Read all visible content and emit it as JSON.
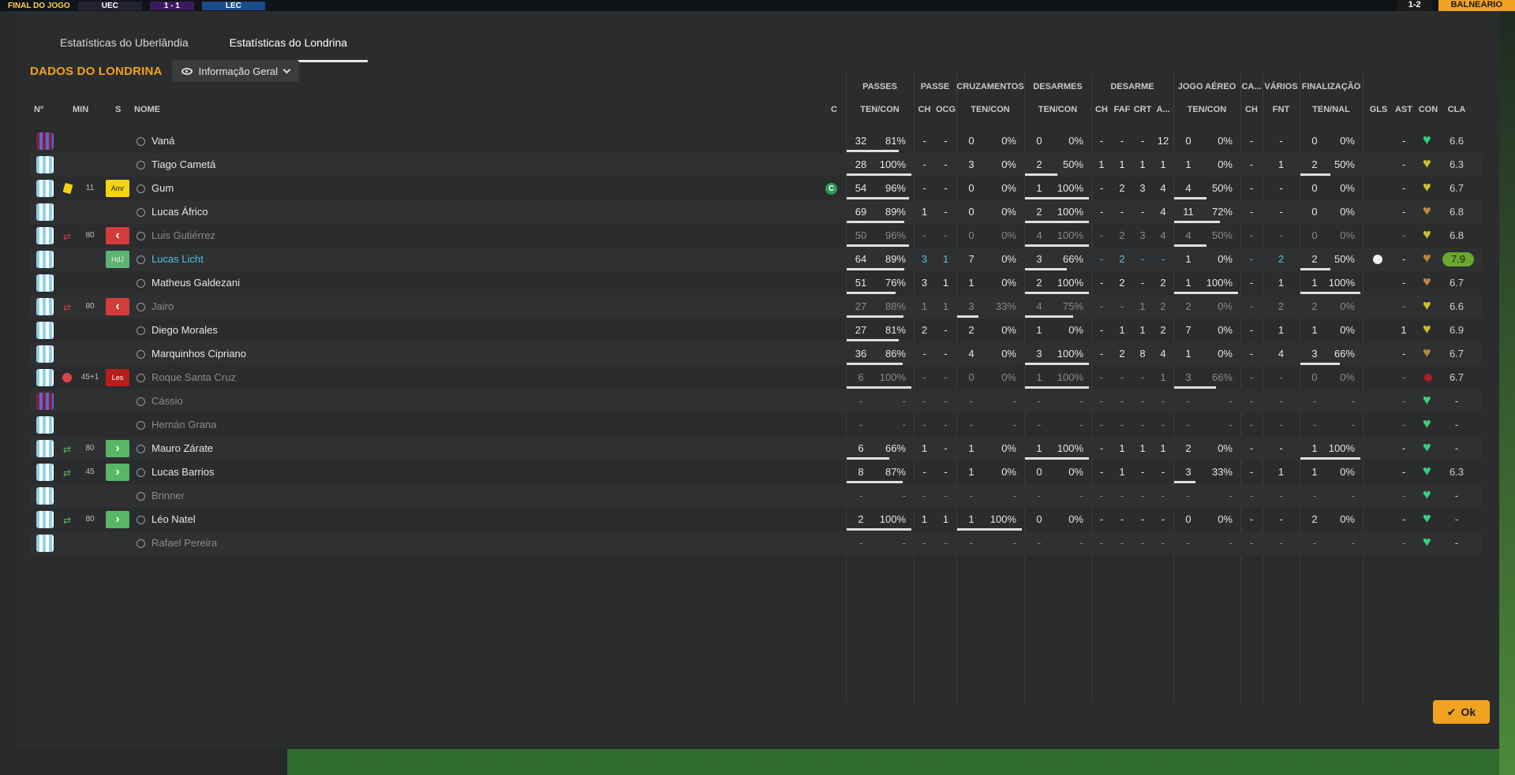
{
  "background": {
    "scoreboard": {
      "league": "FINAL DO JOGO",
      "home": "UEC",
      "score": "1 - 1",
      "away": "LEC"
    },
    "top_right": {
      "minute": "1-2",
      "button": "BALNEÁRIO"
    }
  },
  "tabs": [
    "Estatísticas do Uberlândia",
    "Estatísticas do Londrina"
  ],
  "team_title": "DADOS DO LONDRINA",
  "view_selector": "Informação Geral",
  "headers": {
    "left": {
      "num": "Nº",
      "min": "MIN",
      "s": "S",
      "name": "NOME",
      "c": "C"
    },
    "groups": [
      "PASSES",
      "PASSE",
      "CRUZAMENTOS",
      "DESARMES",
      "DESARME",
      "JOGO AÉREO",
      "CA...",
      "VÁRIOS",
      "FINALIZAÇÃO"
    ],
    "subs": {
      "passes": "TEN/CON",
      "passe_ch": "CH",
      "passe_ocg": "OCG",
      "cruz": "TEN/CON",
      "des": "TEN/CON",
      "d_ch": "CH",
      "d_faf": "FAF",
      "d_crt": "CRT",
      "d_a": "A...",
      "aereo": "TEN/CON",
      "ca_ch": "CH",
      "fnt": "FNT",
      "fin": "TEN/NAL",
      "gls": "GLS",
      "ast": "AST",
      "con": "CON",
      "cla": "CLA"
    }
  },
  "rows": [
    {
      "shirt": "gk",
      "min": "",
      "s": "",
      "name": "Vaná",
      "dim": false,
      "cap": false,
      "pt": "32",
      "pp": "81%",
      "pbar": 0.81,
      "pch": "-",
      "ocg": "-",
      "ct": "0",
      "cp": "0%",
      "cbar": 0,
      "dt": "0",
      "dp": "0%",
      "dbar": 0,
      "dch": "-",
      "faf": "-",
      "crt": "-",
      "a": "12",
      "at": "0",
      "ap": "0%",
      "abar": 0,
      "cach": "-",
      "fnt": "-",
      "ft": "0",
      "fp": "0%",
      "fbar": 0,
      "gls": "",
      "ast": "-",
      "con": "g",
      "cla": "6.6"
    },
    {
      "shirt": "out",
      "min": "",
      "s": "",
      "name": "Tiago Cametá",
      "dim": false,
      "cap": false,
      "pt": "28",
      "pp": "100%",
      "pbar": 1,
      "pch": "-",
      "ocg": "-",
      "ct": "3",
      "cp": "0%",
      "cbar": 0,
      "dt": "2",
      "dp": "50%",
      "dbar": 0.5,
      "dch": "1",
      "faf": "1",
      "crt": "1",
      "a": "1",
      "at": "1",
      "ap": "0%",
      "abar": 0,
      "cach": "-",
      "fnt": "1",
      "ft": "2",
      "fp": "50%",
      "fbar": 0.5,
      "gls": "",
      "ast": "-",
      "con": "y",
      "cla": "6.3"
    },
    {
      "shirt": "out",
      "min": "11",
      "s": "amr",
      "name": "Gum",
      "dim": false,
      "cap": true,
      "pt": "54",
      "pp": "96%",
      "pbar": 0.96,
      "pch": "-",
      "ocg": "-",
      "ct": "0",
      "cp": "0%",
      "cbar": 0,
      "dt": "1",
      "dp": "100%",
      "dbar": 1,
      "dch": "-",
      "faf": "2",
      "crt": "3",
      "a": "4",
      "at": "4",
      "ap": "50%",
      "abar": 0.5,
      "cach": "-",
      "fnt": "-",
      "ft": "0",
      "fp": "0%",
      "fbar": 0,
      "gls": "",
      "ast": "-",
      "con": "y",
      "cla": "6.7"
    },
    {
      "shirt": "out",
      "min": "",
      "s": "",
      "name": "Lucas Áfrico",
      "dim": false,
      "cap": false,
      "pt": "69",
      "pp": "89%",
      "pbar": 0.89,
      "pch": "1",
      "ocg": "-",
      "ct": "0",
      "cp": "0%",
      "cbar": 0,
      "dt": "2",
      "dp": "100%",
      "dbar": 1,
      "dch": "-",
      "faf": "-",
      "crt": "-",
      "a": "4",
      "at": "11",
      "ap": "72%",
      "abar": 0.72,
      "cach": "-",
      "fnt": "-",
      "ft": "0",
      "fp": "0%",
      "fbar": 0,
      "gls": "",
      "ast": "-",
      "con": "o",
      "cla": "6.8"
    },
    {
      "shirt": "out",
      "min": "80",
      "s": "outsub",
      "name": "Luis Gutiérrez",
      "dim": true,
      "cap": false,
      "pt": "50",
      "pp": "96%",
      "pbar": 0.96,
      "pch": "-",
      "ocg": "-",
      "ct": "0",
      "cp": "0%",
      "cbar": 0,
      "dt": "4",
      "dp": "100%",
      "dbar": 1,
      "dch": "-",
      "faf": "2",
      "crt": "3",
      "a": "4",
      "at": "4",
      "ap": "50%",
      "abar": 0.5,
      "cach": "-",
      "fnt": "-",
      "ft": "0",
      "fp": "0%",
      "fbar": 0,
      "gls": "",
      "ast": "-",
      "con": "y",
      "cla": "6.8"
    },
    {
      "shirt": "out",
      "min": "",
      "s": "hdj",
      "name": "Lucas Licht",
      "dim": false,
      "hl": true,
      "cap": false,
      "pt": "64",
      "pp": "89%",
      "pbar": 0.89,
      "pch": "3",
      "ocg": "1",
      "ct": "7",
      "cp": "0%",
      "cbar": 0,
      "dt": "3",
      "dp": "66%",
      "dbar": 0.66,
      "dch": "-",
      "faf": "2",
      "crt": "-",
      "a": "-",
      "at": "1",
      "ap": "0%",
      "abar": 0,
      "cach": "-",
      "fnt": "2",
      "ft": "2",
      "fp": "50%",
      "fbar": 0.5,
      "gls": "ball",
      "ast": "-",
      "con": "o",
      "cla": "7.9"
    },
    {
      "shirt": "out",
      "min": "",
      "s": "",
      "name": "Matheus Galdezani",
      "dim": false,
      "cap": false,
      "pt": "51",
      "pp": "76%",
      "pbar": 0.76,
      "pch": "3",
      "ocg": "1",
      "ct": "1",
      "cp": "0%",
      "cbar": 0,
      "dt": "2",
      "dp": "100%",
      "dbar": 1,
      "dch": "-",
      "faf": "2",
      "crt": "-",
      "a": "2",
      "at": "1",
      "ap": "100%",
      "abar": 1,
      "cach": "-",
      "fnt": "1",
      "ft": "1",
      "fp": "100%",
      "fbar": 1,
      "gls": "",
      "ast": "-",
      "con": "o",
      "cla": "6.7"
    },
    {
      "shirt": "out",
      "min": "80",
      "s": "outsub",
      "name": "Jairo",
      "dim": true,
      "cap": false,
      "pt": "27",
      "pp": "88%",
      "pbar": 0.88,
      "pch": "1",
      "ocg": "1",
      "ct": "3",
      "cp": "33%",
      "cbar": 0.33,
      "dt": "4",
      "dp": "75%",
      "dbar": 0.75,
      "dch": "-",
      "faf": "-",
      "crt": "1",
      "a": "2",
      "at": "2",
      "ap": "0%",
      "abar": 0,
      "cach": "-",
      "fnt": "2",
      "ft": "2",
      "fp": "0%",
      "fbar": 0,
      "gls": "",
      "ast": "-",
      "con": "y",
      "cla": "6.6"
    },
    {
      "shirt": "out",
      "min": "",
      "s": "",
      "name": "Diego Morales",
      "dim": false,
      "cap": false,
      "pt": "27",
      "pp": "81%",
      "pbar": 0.81,
      "pch": "2",
      "ocg": "-",
      "ct": "2",
      "cp": "0%",
      "cbar": 0,
      "dt": "1",
      "dp": "0%",
      "dbar": 0,
      "dch": "-",
      "faf": "1",
      "crt": "1",
      "a": "2",
      "at": "7",
      "ap": "0%",
      "abar": 0,
      "cach": "-",
      "fnt": "1",
      "ft": "1",
      "fp": "0%",
      "fbar": 0,
      "gls": "",
      "ast": "1",
      "con": "y",
      "cla": "6.9"
    },
    {
      "shirt": "out",
      "min": "",
      "s": "",
      "name": "Marquinhos Cipriano",
      "dim": false,
      "cap": false,
      "pt": "36",
      "pp": "86%",
      "pbar": 0.86,
      "pch": "-",
      "ocg": "-",
      "ct": "4",
      "cp": "0%",
      "cbar": 0,
      "dt": "3",
      "dp": "100%",
      "dbar": 1,
      "dch": "-",
      "faf": "2",
      "crt": "8",
      "a": "4",
      "at": "1",
      "ap": "0%",
      "abar": 0,
      "cach": "-",
      "fnt": "4",
      "ft": "3",
      "fp": "66%",
      "fbar": 0.66,
      "gls": "",
      "ast": "-",
      "con": "o",
      "cla": "6.7"
    },
    {
      "shirt": "out",
      "min": "45+1",
      "s": "les",
      "name": "Roque Santa Cruz",
      "dim": true,
      "cap": false,
      "inj": true,
      "pt": "6",
      "pp": "100%",
      "pbar": 1,
      "pch": "-",
      "ocg": "-",
      "ct": "0",
      "cp": "0%",
      "cbar": 0,
      "dt": "1",
      "dp": "100%",
      "dbar": 1,
      "dch": "-",
      "faf": "-",
      "crt": "-",
      "a": "1",
      "at": "3",
      "ap": "66%",
      "abar": 0.66,
      "cach": "-",
      "fnt": "-",
      "ft": "0",
      "fp": "0%",
      "fbar": 0,
      "gls": "",
      "ast": "-",
      "con": "inj",
      "cla": "6.7"
    },
    {
      "shirt": "gk",
      "min": "",
      "s": "",
      "name": "Cássio",
      "dim": true,
      "cap": false,
      "pt": "-",
      "pp": "-",
      "pbar": 0,
      "pch": "-",
      "ocg": "-",
      "ct": "-",
      "cp": "-",
      "cbar": 0,
      "dt": "-",
      "dp": "-",
      "dbar": 0,
      "dch": "-",
      "faf": "-",
      "crt": "-",
      "a": "-",
      "at": "-",
      "ap": "-",
      "abar": 0,
      "cach": "-",
      "fnt": "-",
      "ft": "-",
      "fp": "-",
      "fbar": 0,
      "gls": "",
      "ast": "-",
      "con": "g",
      "cla": "-"
    },
    {
      "shirt": "out",
      "min": "",
      "s": "",
      "name": "Hernán Grana",
      "dim": true,
      "cap": false,
      "pt": "-",
      "pp": "-",
      "pbar": 0,
      "pch": "-",
      "ocg": "-",
      "ct": "-",
      "cp": "-",
      "cbar": 0,
      "dt": "-",
      "dp": "-",
      "dbar": 0,
      "dch": "-",
      "faf": "-",
      "crt": "-",
      "a": "-",
      "at": "-",
      "ap": "-",
      "abar": 0,
      "cach": "-",
      "fnt": "-",
      "ft": "-",
      "fp": "-",
      "fbar": 0,
      "gls": "",
      "ast": "-",
      "con": "g",
      "cla": "-"
    },
    {
      "shirt": "out",
      "min": "80",
      "s": "insub",
      "name": "Mauro Zárate",
      "dim": false,
      "cap": false,
      "pt": "6",
      "pp": "66%",
      "pbar": 0.66,
      "pch": "1",
      "ocg": "-",
      "ct": "1",
      "cp": "0%",
      "cbar": 0,
      "dt": "1",
      "dp": "100%",
      "dbar": 1,
      "dch": "-",
      "faf": "1",
      "crt": "1",
      "a": "1",
      "at": "2",
      "ap": "0%",
      "abar": 0,
      "cach": "-",
      "fnt": "-",
      "ft": "1",
      "fp": "100%",
      "fbar": 1,
      "gls": "",
      "ast": "-",
      "con": "g",
      "cla": "-"
    },
    {
      "shirt": "out",
      "min": "45",
      "s": "insub",
      "name": "Lucas Barrios",
      "dim": false,
      "cap": false,
      "pt": "8",
      "pp": "87%",
      "pbar": 0.87,
      "pch": "-",
      "ocg": "-",
      "ct": "1",
      "cp": "0%",
      "cbar": 0,
      "dt": "0",
      "dp": "0%",
      "dbar": 0,
      "dch": "-",
      "faf": "1",
      "crt": "-",
      "a": "-",
      "at": "3",
      "ap": "33%",
      "abar": 0.33,
      "cach": "-",
      "fnt": "1",
      "ft": "1",
      "fp": "0%",
      "fbar": 0,
      "gls": "",
      "ast": "-",
      "con": "g",
      "cla": "6.3"
    },
    {
      "shirt": "out",
      "min": "",
      "s": "",
      "name": "Brinner",
      "dim": true,
      "cap": false,
      "pt": "-",
      "pp": "-",
      "pbar": 0,
      "pch": "-",
      "ocg": "-",
      "ct": "-",
      "cp": "-",
      "cbar": 0,
      "dt": "-",
      "dp": "-",
      "dbar": 0,
      "dch": "-",
      "faf": "-",
      "crt": "-",
      "a": "-",
      "at": "-",
      "ap": "-",
      "abar": 0,
      "cach": "-",
      "fnt": "-",
      "ft": "-",
      "fp": "-",
      "fbar": 0,
      "gls": "",
      "ast": "-",
      "con": "g",
      "cla": "-"
    },
    {
      "shirt": "out",
      "min": "80",
      "s": "insub",
      "name": "Léo Natel",
      "dim": false,
      "cap": false,
      "pt": "2",
      "pp": "100%",
      "pbar": 1,
      "pch": "1",
      "ocg": "1",
      "ct": "1",
      "cp": "100%",
      "cbar": 1,
      "dt": "0",
      "dp": "0%",
      "dbar": 0,
      "dch": "-",
      "faf": "-",
      "crt": "-",
      "a": "-",
      "at": "0",
      "ap": "0%",
      "abar": 0,
      "cach": "-",
      "fnt": "-",
      "ft": "2",
      "fp": "0%",
      "fbar": 0,
      "gls": "",
      "ast": "-",
      "con": "g",
      "cla": "-"
    },
    {
      "shirt": "out",
      "min": "",
      "s": "",
      "name": "Rafael Pereira",
      "dim": true,
      "cap": false,
      "pt": "-",
      "pp": "-",
      "pbar": 0,
      "pch": "-",
      "ocg": "-",
      "ct": "-",
      "cp": "-",
      "cbar": 0,
      "dt": "-",
      "dp": "-",
      "dbar": 0,
      "dch": "-",
      "faf": "-",
      "crt": "-",
      "a": "-",
      "at": "-",
      "ap": "-",
      "abar": 0,
      "cach": "-",
      "fnt": "-",
      "ft": "-",
      "fp": "-",
      "fbar": 0,
      "gls": "",
      "ast": "-",
      "con": "g",
      "cla": "-"
    }
  ],
  "badge_labels": {
    "amr": "Amr",
    "hdj": "HdJ",
    "les": "Les",
    "outsub": "‹",
    "insub": "›"
  },
  "captain_mark": "C",
  "ok_label": "Ok"
}
